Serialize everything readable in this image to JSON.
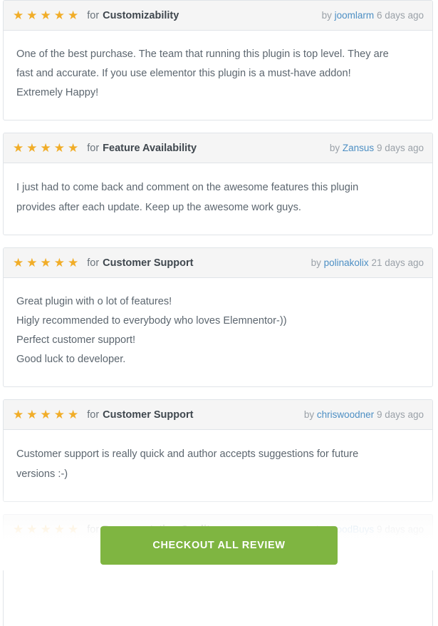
{
  "reviews": [
    {
      "rating": 5,
      "star_glyph": "★",
      "for_label": "for",
      "category": "Customizability",
      "by_label": "by",
      "author": "joomlarm",
      "time_ago": "6 days ago",
      "lines": [
        "One of the best purchase. The team that running this plugin is top level. They are",
        "fast and accurate. If you use elementor this plugin is a must-have addon!",
        "Extremely Happy!"
      ]
    },
    {
      "rating": 5,
      "star_glyph": "★",
      "for_label": "for",
      "category": "Feature Availability",
      "by_label": "by",
      "author": "Zansus",
      "time_ago": "9 days ago",
      "lines": [
        "I just had to come back and comment on the awesome features this plugin",
        "provides after each update. Keep up the awesome work guys."
      ]
    },
    {
      "rating": 5,
      "star_glyph": "★",
      "for_label": "for",
      "category": "Customer Support",
      "by_label": "by",
      "author": "polinakolix",
      "time_ago": "21 days ago",
      "lines": [
        "Great plugin with o lot of features!",
        "Higly recommended to everybody who loves Elemnentor-))",
        "Perfect customer support!",
        "Good luck to developer."
      ]
    },
    {
      "rating": 5,
      "star_glyph": "★",
      "for_label": "for",
      "category": "Customer Support",
      "by_label": "by",
      "author": "chriswoodner",
      "time_ago": "9 days ago",
      "lines": [
        "Customer support is really quick and author accepts suggestions for future",
        "versions :-)"
      ]
    }
  ],
  "teaser_review": {
    "rating": 5,
    "star_glyph": "★",
    "for_label": "for",
    "category": "Documentation Quality",
    "by_label": "by",
    "author": "GoodBuys",
    "time_ago": "9 days ago"
  },
  "cta": {
    "label": "CHECKOUT ALL REVIEW",
    "color": "#7fb541"
  },
  "colors": {
    "star": "#f1ad28",
    "link": "#4d8fc4",
    "body_text": "#5c666f",
    "header_bg": "#f5f5f5",
    "border": "#e0e4e8",
    "category": "#3f474e",
    "meta": "#9aa1a8"
  }
}
